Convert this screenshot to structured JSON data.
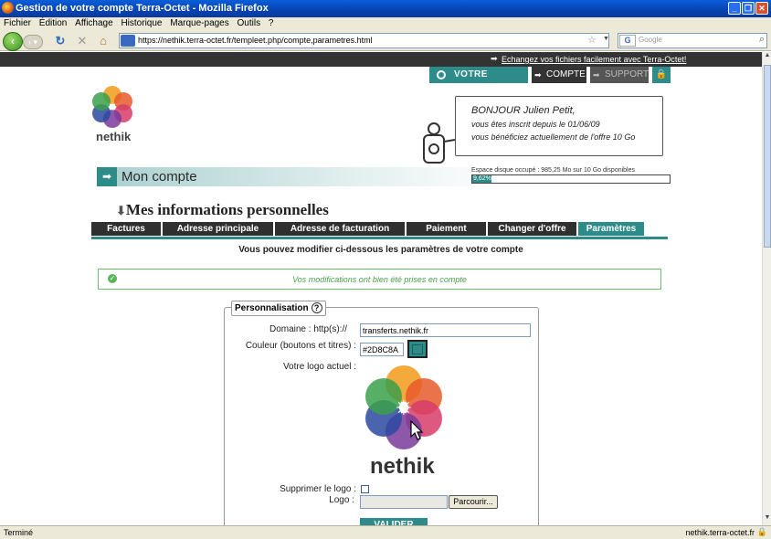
{
  "window": {
    "title": "Gestion de votre compte Terra-Octet - Mozilla Firefox"
  },
  "menu": [
    "Fichier",
    "Édition",
    "Affichage",
    "Historique",
    "Marque-pages",
    "Outils",
    "?"
  ],
  "browser": {
    "url": "https://nethik.terra-octet.fr/templeet.php/compte,parametres.html",
    "search_placeholder": "Google",
    "search_engine": "G"
  },
  "site": {
    "top_link": "Echangez vos fichiers facilement avec Terra-Octet!",
    "nav": {
      "espace": "VOTRE ESPACE",
      "compte": "COMPTE",
      "support": "SUPPORT"
    },
    "logo_text": "nethik",
    "greeting": {
      "hello": "BONJOUR Julien Petit,",
      "line1": "vous êtes inscrit depuis le 01/06/09",
      "line2": "vous bénéficiez actuellement de l'offre 10 Go"
    },
    "section_header": "Mon compte",
    "disk": {
      "label": "Espace disque occupé : 985,25 Mo sur 10 Go disponibles",
      "percent_text": "9,62%",
      "fraction": 0.0962
    },
    "page_title": "Mes informations personnelles",
    "tabs": [
      "Factures",
      "Adresse principale",
      "Adresse de facturation",
      "Paiement",
      "Changer d'offre",
      "Paramètres"
    ],
    "active_tab": "Paramètres",
    "info": "Vous pouvez modifier ci-dessous les paramètres de votre compte",
    "success": "Vos modifications ont bien été prises en compte",
    "form": {
      "legend": "Personnalisation",
      "help": "?",
      "domain_label": "Domaine : http(s)://",
      "domain_value": "transferts.nethik.fr",
      "color_label": "Couleur (boutons et titres) :",
      "color_value": "#2D8C8A",
      "logo_label": "Votre logo actuel :",
      "delete_logo_label": "Supprimer le logo :",
      "logo_upload_label": "Logo :",
      "browse_label": "Parcourir...",
      "submit_label": "VALIDER"
    }
  },
  "status": {
    "left": "Terminé",
    "right": "nethik.terra-octet.fr"
  },
  "colors": {
    "accent": "#2D8C8A",
    "success": "#4aa04a",
    "dark": "#333333"
  }
}
